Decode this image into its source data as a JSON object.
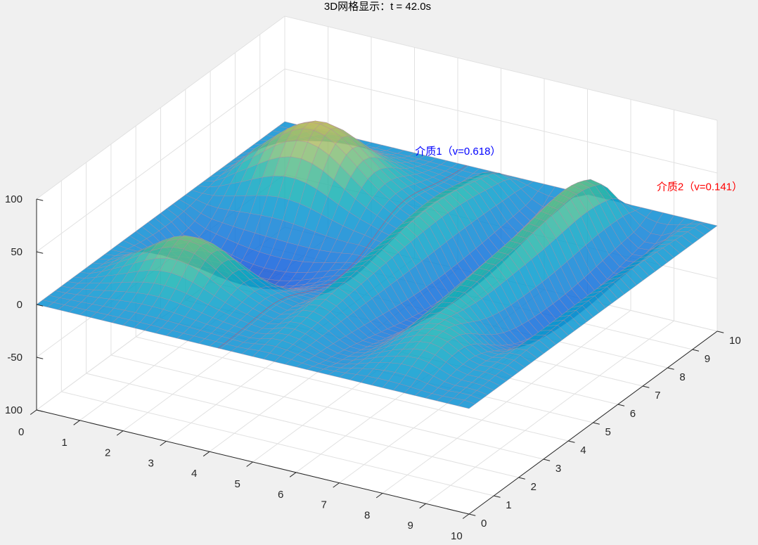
{
  "chart_data": {
    "type": "surface",
    "title": "3D网格显示：t = 42.0s",
    "xlabel": "",
    "ylabel": "",
    "zlabel": "",
    "xlim": [
      0,
      10
    ],
    "ylim": [
      0,
      10
    ],
    "zlim": [
      -100,
      100
    ],
    "x_ticks": [
      "0",
      "1",
      "2",
      "3",
      "4",
      "5",
      "6",
      "7",
      "8",
      "9",
      "10"
    ],
    "y_ticks": [
      "0",
      "1",
      "2",
      "3",
      "4",
      "5",
      "6",
      "7",
      "8",
      "9",
      "10"
    ],
    "z_ticks": [
      "100",
      "-50",
      "0",
      "50",
      "100"
    ],
    "z_tick_values": [
      -100,
      -50,
      0,
      50,
      100
    ],
    "grid": true,
    "colormap": "parula",
    "interface_x": 4.2,
    "surface_peaks": [
      {
        "x": 2.2,
        "y": 7.3,
        "z": 75
      },
      {
        "x": 2.2,
        "y": 2.5,
        "z": 55
      },
      {
        "x": 2.3,
        "y": 4.9,
        "z": -45
      },
      {
        "x": 7.5,
        "y": 8.5,
        "z": 40
      },
      {
        "x": 8.5,
        "y": 6.5,
        "z": 35
      },
      {
        "x": 8.5,
        "y": 2.0,
        "z": 30
      }
    ],
    "annotations": [
      {
        "text": "介质1（v=0.618）",
        "color": "#0000ff",
        "x": 3.3,
        "y": 9.5,
        "z": 10
      },
      {
        "text": "介质2（v=0.141）",
        "color": "#ff0000",
        "x": 8.6,
        "y": 10.0,
        "z": 20
      }
    ]
  }
}
